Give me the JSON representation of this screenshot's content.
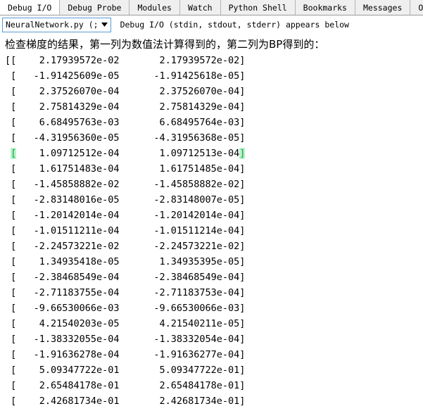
{
  "window": {
    "title": "Debug I/O"
  },
  "tabs": [
    {
      "label": "Debug I/O",
      "active": true,
      "name": "tab-debug-io"
    },
    {
      "label": "Debug Probe",
      "active": false,
      "name": "tab-debug-probe"
    },
    {
      "label": "Modules",
      "active": false,
      "name": "tab-modules"
    },
    {
      "label": "Watch",
      "active": false,
      "name": "tab-watch"
    },
    {
      "label": "Python Shell",
      "active": false,
      "name": "tab-python-shell"
    },
    {
      "label": "Bookmarks",
      "active": false,
      "name": "tab-bookmarks"
    },
    {
      "label": "Messages",
      "active": false,
      "name": "tab-messages"
    },
    {
      "label": "OS Comman",
      "active": false,
      "name": "tab-os-command"
    }
  ],
  "toolbar": {
    "file_selector_value": "NeuralNetwork.py (;",
    "caret_icon": "chevron-down-icon",
    "note": "Debug I/O (stdin, stdout, stderr) appears below"
  },
  "console": {
    "message": "检查梯度的结果，第一列为数值法计算得到的，第二列为BP得到的：",
    "highlight_color": "#b9f2c9",
    "highlight_row_index": 6,
    "rows": [
      {
        "open": "[[",
        "col1": "2.17939572e-02",
        "col2": "2.17939572e-02",
        "close": "]",
        "highlighted": false
      },
      {
        "open": " [",
        "col1": "-1.91425609e-05",
        "col2": "-1.91425618e-05",
        "close": "]",
        "highlighted": false
      },
      {
        "open": " [",
        "col1": "2.37526070e-04",
        "col2": "2.37526070e-04",
        "close": "]",
        "highlighted": false
      },
      {
        "open": " [",
        "col1": "2.75814329e-04",
        "col2": "2.75814329e-04",
        "close": "]",
        "highlighted": false
      },
      {
        "open": " [",
        "col1": "6.68495763e-03",
        "col2": "6.68495764e-03",
        "close": "]",
        "highlighted": false
      },
      {
        "open": " [",
        "col1": "-4.31956360e-05",
        "col2": "-4.31956368e-05",
        "close": "]",
        "highlighted": false
      },
      {
        "open": " [",
        "col1": "1.09712512e-04",
        "col2": "1.09712513e-04",
        "close": "]",
        "highlighted": true
      },
      {
        "open": " [",
        "col1": "1.61751483e-04",
        "col2": "1.61751485e-04",
        "close": "]",
        "highlighted": false
      },
      {
        "open": " [",
        "col1": "-1.45858882e-02",
        "col2": "-1.45858882e-02",
        "close": "]",
        "highlighted": false
      },
      {
        "open": " [",
        "col1": "-2.83148016e-05",
        "col2": "-2.83148007e-05",
        "close": "]",
        "highlighted": false
      },
      {
        "open": " [",
        "col1": "-1.20142014e-04",
        "col2": "-1.20142014e-04",
        "close": "]",
        "highlighted": false
      },
      {
        "open": " [",
        "col1": "-1.01511211e-04",
        "col2": "-1.01511214e-04",
        "close": "]",
        "highlighted": false
      },
      {
        "open": " [",
        "col1": "-2.24573221e-02",
        "col2": "-2.24573221e-02",
        "close": "]",
        "highlighted": false
      },
      {
        "open": " [",
        "col1": "1.34935418e-05",
        "col2": "1.34935395e-05",
        "close": "]",
        "highlighted": false
      },
      {
        "open": " [",
        "col1": "-2.38468549e-04",
        "col2": "-2.38468549e-04",
        "close": "]",
        "highlighted": false
      },
      {
        "open": " [",
        "col1": "-2.71183755e-04",
        "col2": "-2.71183753e-04",
        "close": "]",
        "highlighted": false
      },
      {
        "open": " [",
        "col1": "-9.66530066e-03",
        "col2": "-9.66530066e-03",
        "close": "]",
        "highlighted": false
      },
      {
        "open": " [",
        "col1": "4.21540203e-05",
        "col2": "4.21540211e-05",
        "close": "]",
        "highlighted": false
      },
      {
        "open": " [",
        "col1": "-1.38332055e-04",
        "col2": "-1.38332054e-04",
        "close": "]",
        "highlighted": false
      },
      {
        "open": " [",
        "col1": "-1.91636278e-04",
        "col2": "-1.91636277e-04",
        "close": "]",
        "highlighted": false
      },
      {
        "open": " [",
        "col1": "5.09347722e-01",
        "col2": "5.09347722e-01",
        "close": "]",
        "highlighted": false
      },
      {
        "open": " [",
        "col1": "2.65484178e-01",
        "col2": "2.65484178e-01",
        "close": "]",
        "highlighted": false
      },
      {
        "open": " [",
        "col1": "2.42681734e-01",
        "col2": "2.42681734e-01",
        "close": "]",
        "highlighted": false
      }
    ]
  }
}
